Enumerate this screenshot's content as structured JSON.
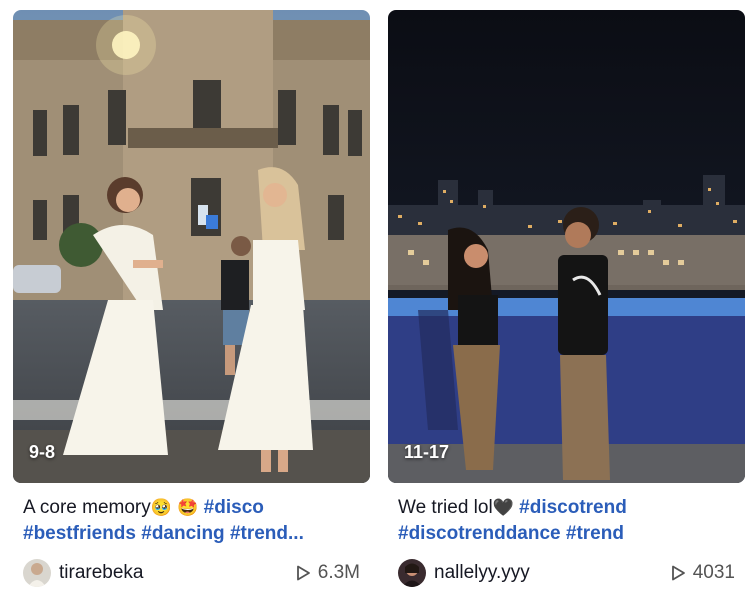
{
  "videos": [
    {
      "badge": "9-8",
      "caption_text": "A core memory",
      "emoji": [
        "🥹",
        "🤩"
      ],
      "hashtags_line1": [
        "#disco"
      ],
      "hashtags_line2": "#bestfriends #dancing #trend...",
      "username": "tirarebeka",
      "play_count": "6.3M"
    },
    {
      "badge": "11-17",
      "caption_text": "We tried lol",
      "emoji": [
        "🖤"
      ],
      "hashtags_line1": [
        "#discotrend"
      ],
      "hashtags_line2": "#discotrenddance #trend",
      "username": "nallelyy.yyy",
      "play_count": "4031"
    }
  ],
  "colors": {
    "hashtag": "#2b5db9",
    "text": "#161823",
    "muted": "#545454"
  },
  "icons": {
    "play": "play-icon"
  }
}
